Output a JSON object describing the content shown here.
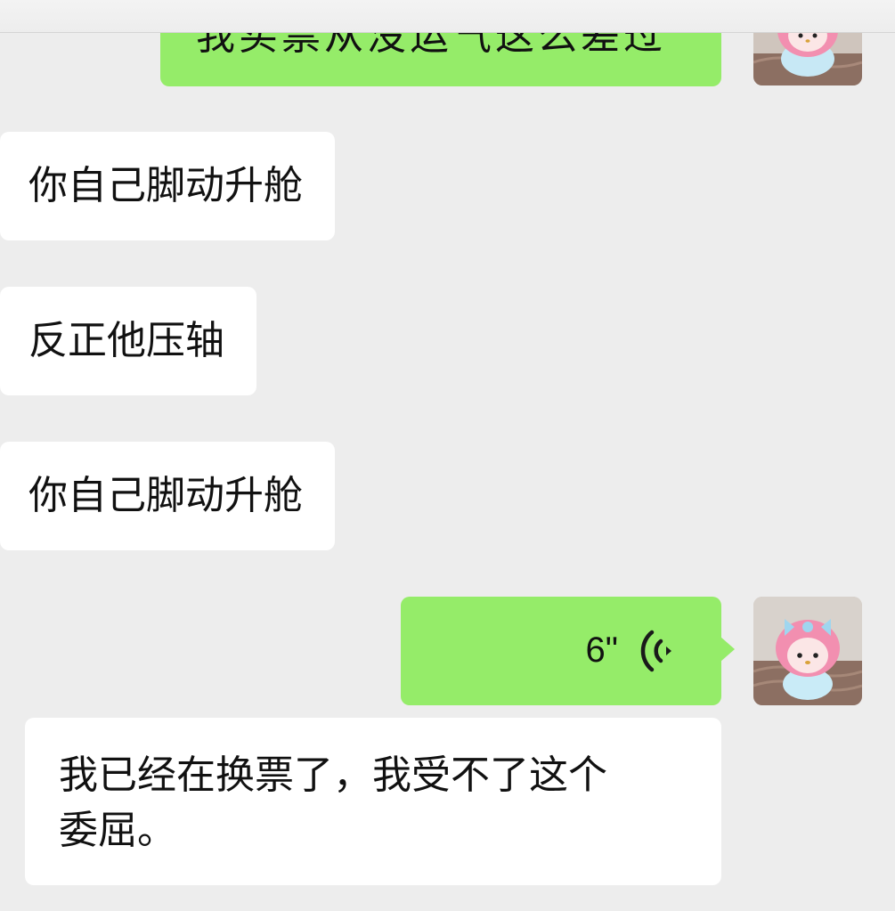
{
  "messages": [
    {
      "sender": "self",
      "type": "text",
      "text": "我买票从没运气这么差过"
    },
    {
      "sender": "other",
      "type": "text",
      "text": "你自己脚动升舱"
    },
    {
      "sender": "other",
      "type": "text",
      "text": "反正他压轴"
    },
    {
      "sender": "other",
      "type": "text",
      "text": "你自己脚动升舱"
    },
    {
      "sender": "self",
      "type": "voice",
      "duration": "6\""
    },
    {
      "sender": "other",
      "type": "text",
      "lines": [
        "我已经在换票了，我受不了这个",
        "委屈。"
      ]
    }
  ],
  "colors": {
    "background": "#ededed",
    "outgoing_bubble": "#95ec69",
    "incoming_bubble": "#ffffff"
  },
  "icons": {
    "voice": "voice-wave-icon",
    "avatar": "avatar-pink-bunny-plush"
  }
}
